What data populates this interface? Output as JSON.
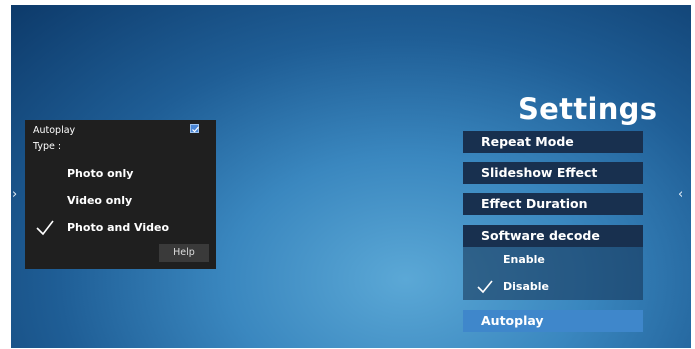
{
  "settings": {
    "title": "Settings",
    "menu": [
      {
        "label": "Repeat Mode"
      },
      {
        "label": "Slideshow Effect"
      },
      {
        "label": "Effect Duration"
      },
      {
        "label": "Software decode"
      },
      {
        "label": "Autoplay"
      }
    ],
    "software_decode_options": [
      {
        "label": "Enable",
        "selected": false
      },
      {
        "label": "Disable",
        "selected": true
      }
    ],
    "active_item": "Autoplay"
  },
  "popup": {
    "title": "Autoplay",
    "checked": true,
    "type_label": "Type :",
    "options": [
      {
        "label": "Photo only",
        "selected": false
      },
      {
        "label": "Video only",
        "selected": false
      },
      {
        "label": "Photo and Video",
        "selected": true
      }
    ],
    "help_label": "Help"
  },
  "nav": {
    "left_glyph": "›",
    "right_glyph": "‹"
  },
  "colors": {
    "menu_bg": "#18304f",
    "menu_active_bg": "#3f87cb",
    "popup_bg": "#1f1f1f",
    "checkbox": "#4a86d6"
  }
}
